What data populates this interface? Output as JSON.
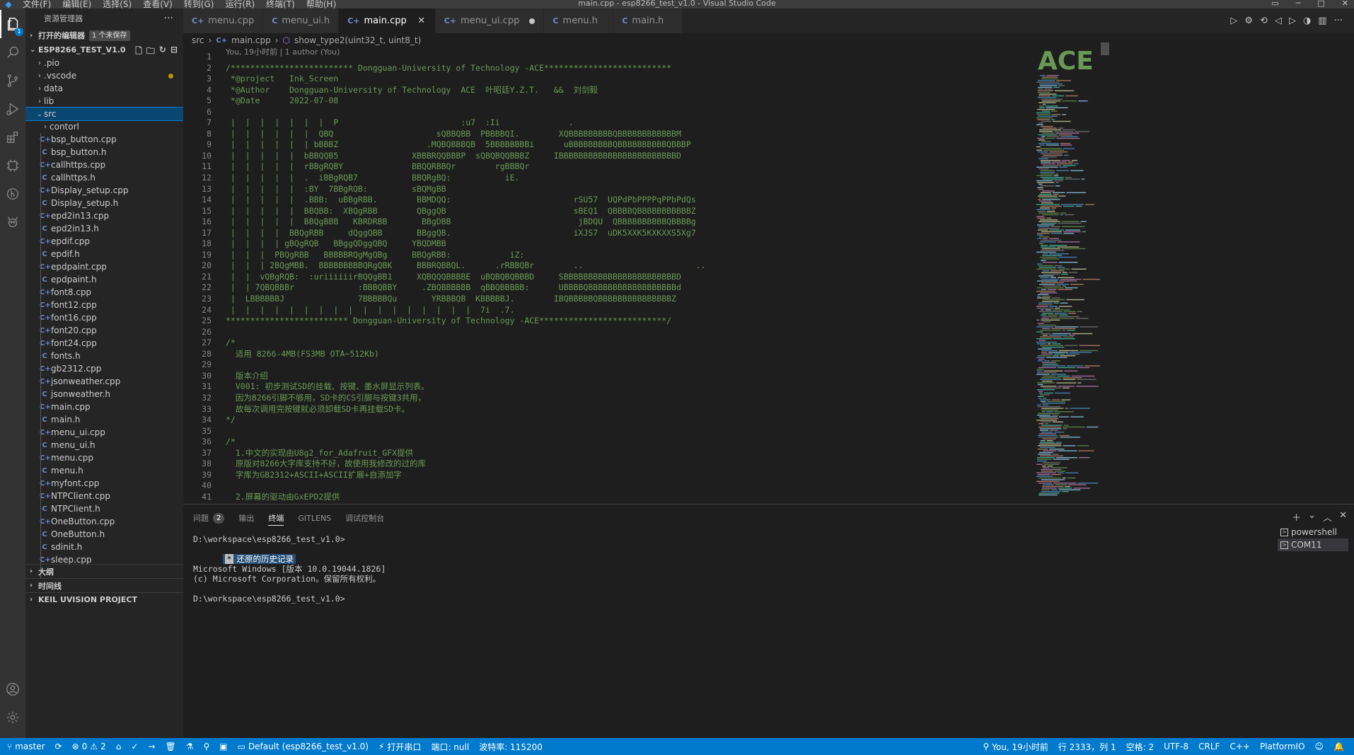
{
  "window": {
    "title": "main.cpp - esp8266_test_v1.0 - Visual Studio Code",
    "menus": [
      "文件(F)",
      "编辑(E)",
      "选择(S)",
      "查看(V)",
      "转到(G)",
      "运行(R)",
      "终端(T)",
      "帮助(H)"
    ]
  },
  "activity_bar": {
    "explorer_badge": "1",
    "items": [
      "explorer",
      "search",
      "source-control",
      "run-debug",
      "extensions",
      "platformio",
      "gitlens",
      "remote",
      "accounts",
      "settings"
    ]
  },
  "sidebar": {
    "title": "资源管理器",
    "more": "···",
    "open_editors": {
      "label": "打开的编辑器",
      "tag": "1 个未保存"
    },
    "project": {
      "label": "ESP8266_TEST_V1.0"
    },
    "folders": [
      ".pio",
      ".vscode",
      "data",
      "lib",
      "src",
      "contorl"
    ],
    "files": [
      {
        "name": "bsp_button.cpp",
        "type": "cpp"
      },
      {
        "name": "bsp_button.h",
        "type": "c"
      },
      {
        "name": "callhttps.cpp",
        "type": "cpp"
      },
      {
        "name": "callhttps.h",
        "type": "c"
      },
      {
        "name": "Display_setup.cpp",
        "type": "cpp"
      },
      {
        "name": "Display_setup.h",
        "type": "c"
      },
      {
        "name": "epd2in13.cpp",
        "type": "cpp"
      },
      {
        "name": "epd2in13.h",
        "type": "c"
      },
      {
        "name": "epdif.cpp",
        "type": "cpp"
      },
      {
        "name": "epdif.h",
        "type": "c"
      },
      {
        "name": "epdpaint.cpp",
        "type": "cpp"
      },
      {
        "name": "epdpaint.h",
        "type": "c"
      },
      {
        "name": "font8.cpp",
        "type": "cpp"
      },
      {
        "name": "font12.cpp",
        "type": "cpp"
      },
      {
        "name": "font16.cpp",
        "type": "cpp"
      },
      {
        "name": "font20.cpp",
        "type": "cpp"
      },
      {
        "name": "font24.cpp",
        "type": "cpp"
      },
      {
        "name": "fonts.h",
        "type": "c"
      },
      {
        "name": "gb2312.cpp",
        "type": "cpp"
      },
      {
        "name": "jsonweather.cpp",
        "type": "cpp"
      },
      {
        "name": "jsonweather.h",
        "type": "c"
      },
      {
        "name": "main.cpp",
        "type": "cpp"
      },
      {
        "name": "main.h",
        "type": "c"
      },
      {
        "name": "menu_ui.cpp",
        "type": "cpp"
      },
      {
        "name": "menu_ui.h",
        "type": "c"
      },
      {
        "name": "menu.cpp",
        "type": "cpp"
      },
      {
        "name": "menu.h",
        "type": "c"
      },
      {
        "name": "myfont.cpp",
        "type": "cpp"
      },
      {
        "name": "NTPClient.cpp",
        "type": "cpp"
      },
      {
        "name": "NTPClient.h",
        "type": "c"
      },
      {
        "name": "OneButton.cpp",
        "type": "cpp"
      },
      {
        "name": "OneButton.h",
        "type": "c"
      },
      {
        "name": "sdinit.h",
        "type": "c"
      },
      {
        "name": "sleep.cpp",
        "type": "cpp"
      }
    ],
    "bottom_sections": [
      "大纲",
      "时间线",
      "KEIL UVISION PROJECT"
    ]
  },
  "tabs": [
    {
      "label": "menu.cpp",
      "icon": "C+",
      "state": ""
    },
    {
      "label": "menu_ui.h",
      "icon": "C",
      "state": ""
    },
    {
      "label": "main.cpp",
      "icon": "C+",
      "state": "active"
    },
    {
      "label": "menu_ui.cpp",
      "icon": "C+",
      "state": "dirty"
    },
    {
      "label": "menu.h",
      "icon": "C",
      "state": ""
    },
    {
      "label": "main.h",
      "icon": "C",
      "state": ""
    }
  ],
  "breadcrumb": {
    "folder": "src",
    "file": "main.cpp",
    "symbol": "show_type2(uint32_t, uint8_t)"
  },
  "editor": {
    "blame": "You, 19小时前 | 1 author (You)",
    "lines": [
      "",
      "/************************* Dongguan-University of Technology -ACE**************************",
      " *@project   Ink_Screen",
      " *@Author    Dongguan-University of Technology  ACE  叶昭廷Y.Z.T.   &&  刘剑毅",
      " *@Date      2022-07-08",
      "",
      " |  |  |  |  |  |  |  P                         :u7  :Ii              .",
      " |  |  |  |  |  |  QBQ                     sQBBQBB  PBBBBQI.        XQBBBBBBBBBQBBBBBBBBBBBBM",
      " |  |  |  |  |  | bBBBZ                  .MQBQBBBQB  5BBBBBBBBi      uBBBBBBBBBQBBBBBBBBBBQBBBP",
      " |  |  |  |  |  bBBQQB5               XBBBRQQBBBP  sQBQBQQBBBZ     IBBBBBBBBBBBBBBBBBBBBBBBBD",
      " |  |  |  |  |  rBBgRQBY              BBQQRBBQr        rgBBBQr",
      " |  |  |  |  |  .  iBBgRQB7           BBQRgBQ:           iE.",
      " |  |  |  |  |  :BY  7BBgRQB:         sBQMgBB",
      " |  |  |  |  |  .BBB:  uBBgRBB.        BBMDQQ:                         rSU57  UQPdPbPPPPqPPbPdQs",
      " |  |  |  |  |  BBQBB:  XBQgRBB        QBggQB                          sBEQ1  QBBBBQBBBBBBBBBBBZ",
      " |  |  |  |  |  BBQgBBB   KBRDRBB       BBgDBB                          jBDQU  QBBBBBBBBBBQBBBBg",
      " |  |  |  |  BBQgRBB     dQggQBB       BBggQB.                         iXJS7  uDK5XXK5KXKXXS5Xg7",
      " |  |  |  | gBQgRQB   BBggQDggQBQ     YBQDMBB",
      " |  |  |  PBQgRBB   BBBBBRQgMgQBg     BBQgRBB:            iZ:",
      " |  |  | 2BQgMBB.  BBBBBBBBBQRgQBK     BBBRQBBQL.      .rRBBQBr        ..                       ..",
      " |  |  vQBgRQB:  :uriiiiiirBQQgBB1     XQBQQQBBBBE  uBQBQBQBBBD     SBBBBBBBBBBBBBBBBBBBBBBBD",
      " |  | 7QBQBBBr             :BBBQBBY     .ZBQBBBBBB  qBBQBBBBB:      UBBBBQBBBBBBBBBBBBBBBBBBd",
      " |  LBBBBBBJ               7BBBBBQu       YRBBBQB  KBBBBBJ.        IBQBBBBBQBBBBBBBBBBBBBBBZ",
      " |  |  |  |  |  |  |  |  |  |  |  |  |  |  |  |  |  7i  .7.",
      "************************* Dongguan-University of Technology -ACE**************************/",
      "",
      "/*",
      "  适用 8266-4MB(FS3MB OTA~512Kb)",
      "",
      "  版本介绍",
      "  V001: 初步测试SD的挂载、按键、墨水屏显示列表。",
      "  因为8266引脚不够用，SD卡的CS引脚与按键3共用，",
      "  故每次调用完按键就必须卸载SD卡再挂载SD卡。",
      "*/",
      "",
      "/*",
      "  1.中文的实现由U8g2_for_Adafruit_GFX提供",
      "  原版对8266大字库支持不好，故使用我修改的过的库",
      "  字库为GB2312+ASCII+ASCII扩展+自添加字",
      "",
      "  2.屏幕的驱动由GxEPD2提供"
    ]
  },
  "minimap": {
    "logo_text": "ACE"
  },
  "panel": {
    "tabs": [
      {
        "label": "问题",
        "badge": "2"
      },
      {
        "label": "输出",
        "badge": ""
      },
      {
        "label": "终端",
        "badge": "",
        "active": true
      },
      {
        "label": "GITLENS",
        "badge": ""
      },
      {
        "label": "调试控制台",
        "badge": ""
      }
    ],
    "terminal_lines": [
      "D:\\workspace\\esp8266_test_v1.0>",
      "",
      "",
      "Microsoft Windows [版本 10.0.19044.1826]",
      "(c) Microsoft Corporation。保留所有权利。",
      "",
      "D:\\workspace\\esp8266_test_v1.0>"
    ],
    "restore_mark": "*",
    "restore_text": "还原的历史记录",
    "terminals": [
      "powershell",
      "COM11"
    ]
  },
  "statusbar": {
    "branch": "master",
    "errors": "0",
    "warnings": "2",
    "env": "Default (esp8266_test_v1.0)",
    "serial_open": "打开串口",
    "port": "端口: null",
    "baud": "波特率: 115200",
    "blame": "You, 19小时前",
    "position": "行 2333，列 1",
    "spaces": "空格: 2",
    "encoding": "UTF-8",
    "eol": "CRLF",
    "language": "C++",
    "platform": "PlatformIO"
  },
  "colors": {
    "accent": "#007acc",
    "comment": "#6a9955",
    "keyword": "#569cd6",
    "selection": "#094771"
  }
}
